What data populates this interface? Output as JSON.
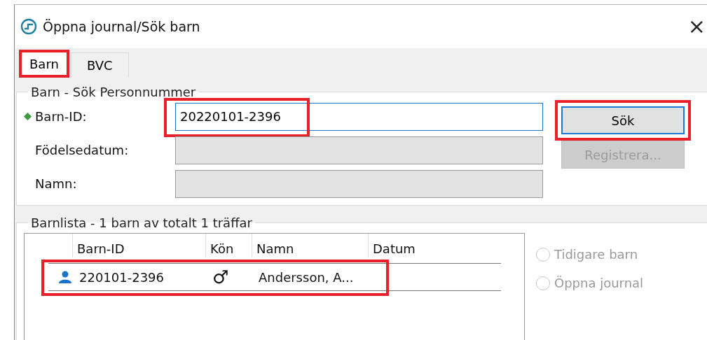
{
  "window": {
    "title": "Öppna journal/Sök barn",
    "close": "×"
  },
  "tabs": [
    {
      "label": "Barn",
      "selected": true,
      "highlighted": true
    },
    {
      "label": "BVC",
      "selected": false,
      "highlighted": false
    }
  ],
  "search_group": {
    "title": "Barn - Sök Personnummer",
    "fields": [
      {
        "label": "Barn-ID:",
        "value": "20220101-2396",
        "required": true,
        "disabled": false,
        "focused": true,
        "highlighted": true
      },
      {
        "label": "Födelsedatum:",
        "required": false,
        "disabled": true,
        "focused": false,
        "highlighted": false
      },
      {
        "label": "Namn:",
        "required": false,
        "disabled": true,
        "focused": false,
        "highlighted": false
      }
    ],
    "buttons": [
      {
        "label": "Sök",
        "disabled": false,
        "focused": true,
        "highlighted": true
      },
      {
        "label": "Registrera...",
        "disabled": true,
        "focused": false,
        "highlighted": false
      }
    ]
  },
  "list_group": {
    "title": "Barnlista - 1 barn av totalt 1 träffar",
    "columns": [
      "Barn-ID",
      "Kön",
      "Namn",
      "Datum"
    ],
    "rows": [
      {
        "id": "220101-2396",
        "sex": "♂",
        "name": "Andersson, A...",
        "date": "",
        "selected": false,
        "highlighted": true
      }
    ],
    "options": [
      {
        "label": "Tidigare barn",
        "selected": false,
        "disabled": true
      },
      {
        "label": "Öppna journal",
        "selected": false,
        "disabled": true
      }
    ]
  }
}
